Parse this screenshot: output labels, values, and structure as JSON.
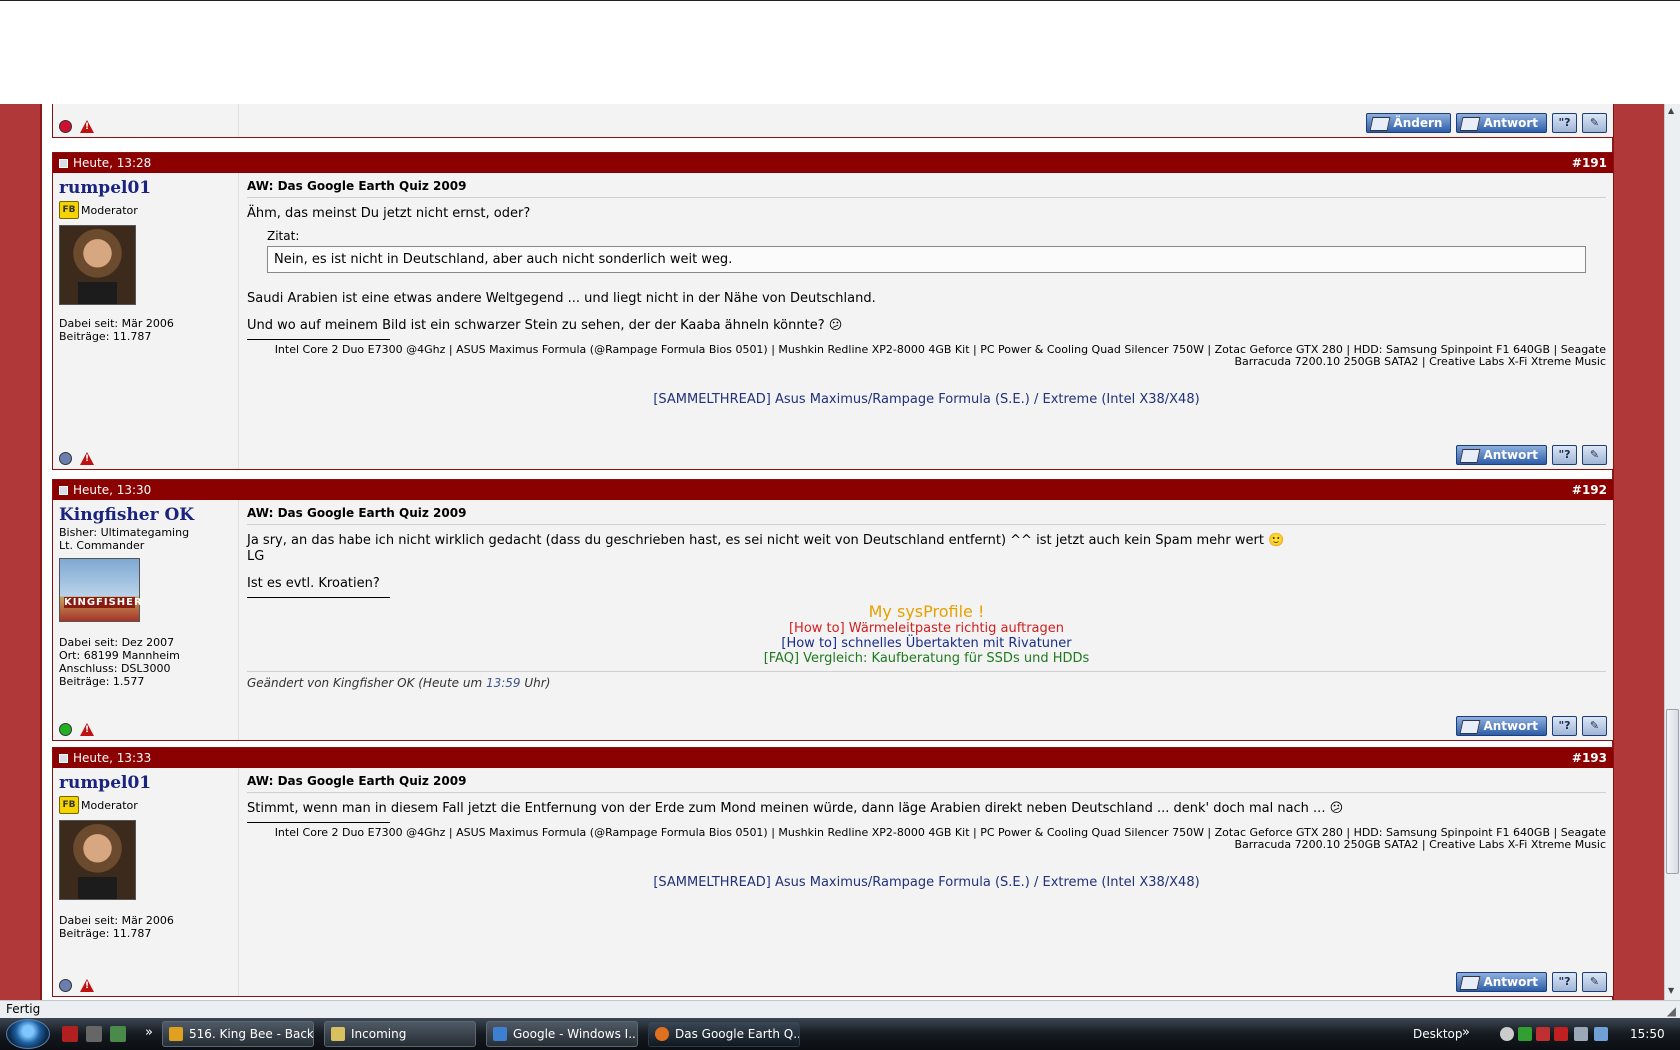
{
  "colors": {
    "header_red": "#8b0000",
    "page_border": "#b03838",
    "button_blue": "#2d5da8",
    "link_blue": "#22317a"
  },
  "top_post_buttons": {
    "edit": "Ändern",
    "reply": "Antwort"
  },
  "posts": [
    {
      "time": "Heute, 13:28",
      "number": "#191",
      "username": "rumpel01",
      "rank_icon": "FB",
      "rank": "Moderator",
      "joined": "Dabei seit: Mär 2006",
      "posts_count": "Beiträge: 11.787",
      "title": "AW: Das Google Earth Quiz 2009",
      "text1": "Ähm, das meinst Du jetzt nicht ernst, oder?",
      "quote_label": "Zitat:",
      "quote_text": "Nein, es ist nicht in Deutschland, aber auch nicht sonderlich weit weg.",
      "text2": "Saudi Arabien ist eine etwas andere Weltgegend ... und liegt nicht in der Nähe von Deutschland.",
      "text3": "Und wo auf meinem Bild ist ein schwarzer Stein zu sehen, der der Kaaba ähneln könnte? 😕",
      "sig": "Intel Core 2 Duo E7300 @4Ghz | ASUS Maximus Formula (@Rampage Formula Bios 0501) | Mushkin Redline XP2-8000 4GB Kit | PC Power & Cooling Quad Silencer 750W | Zotac Geforce GTX 280 | HDD: Samsung Spinpoint F1 640GB | Seagate Barracuda 7200.10 250GB SATA2 | Creative Labs X-Fi Xtreme Music",
      "sig_link": "[SAMMELTHREAD] Asus Maximus/Rampage Formula (S.E.) / Extreme (Intel X38/X48)",
      "reply_label": "Antwort"
    },
    {
      "time": "Heute, 13:30",
      "number": "#192",
      "username": "Kingfisher OK",
      "sub1": "Bisher: Ultimategaming",
      "sub2": "Lt. Commander",
      "avatar_text": "KINGFISHER",
      "joined": "Dabei seit: Dez 2007",
      "location": "Ort: 68199 Mannheim",
      "connection": "Anschluss: DSL3000",
      "posts_count": "Beiträge: 1.577",
      "title": "AW: Das Google Earth Quiz 2009",
      "text1": "Ja sry, an das habe ich nicht wirklich gedacht (dass du geschrieben hast, es sei nicht weit von Deutschland entfernt) ^^ ist jetzt auch kein Spam mehr wert 🙂",
      "text1b": "LG",
      "text2": "Ist es evtl. Kroatien?",
      "sig_line1": "My sysProfile !",
      "sig_line2": "[How to] Wärmeleitpaste richtig auftragen",
      "sig_line3": "[How to] schnelles Übertakten mit Rivatuner",
      "sig_line4": "[FAQ] Vergleich: Kaufberatung für SSDs und HDDs",
      "edited_pre": "Geändert von Kingfisher OK (Heute um ",
      "edited_time": "13:59",
      "edited_post": " Uhr)",
      "reply_label": "Antwort"
    },
    {
      "time": "Heute, 13:33",
      "number": "#193",
      "username": "rumpel01",
      "rank_icon": "FB",
      "rank": "Moderator",
      "joined": "Dabei seit: Mär 2006",
      "posts_count": "Beiträge: 11.787",
      "title": "AW: Das Google Earth Quiz 2009",
      "text1": "Stimmt, wenn man in diesem Fall jetzt die Entfernung von der Erde zum Mond meinen würde, dann läge Arabien direkt neben Deutschland ... denk' doch mal nach ... 😕",
      "sig": "Intel Core 2 Duo E7300 @4Ghz | ASUS Maximus Formula (@Rampage Formula Bios 0501) | Mushkin Redline XP2-8000 4GB Kit | PC Power & Cooling Quad Silencer 750W | Zotac Geforce GTX 280 | HDD: Samsung Spinpoint F1 640GB | Seagate Barracuda 7200.10 250GB SATA2 | Creative Labs X-Fi Xtreme Music",
      "sig_link": "[SAMMELTHREAD] Asus Maximus/Rampage Formula (S.E.) / Extreme (Intel X38/X48)",
      "reply_label": "Antwort"
    }
  ],
  "status_bar": {
    "text": "Fertig"
  },
  "taskbar": {
    "overflow": "»",
    "tasks": [
      "516. King Bee - Back...",
      "Incoming",
      "Google - Windows I...",
      "Das Google Earth Q..."
    ],
    "desktop_label": "Desktop",
    "clock": "15:50"
  }
}
